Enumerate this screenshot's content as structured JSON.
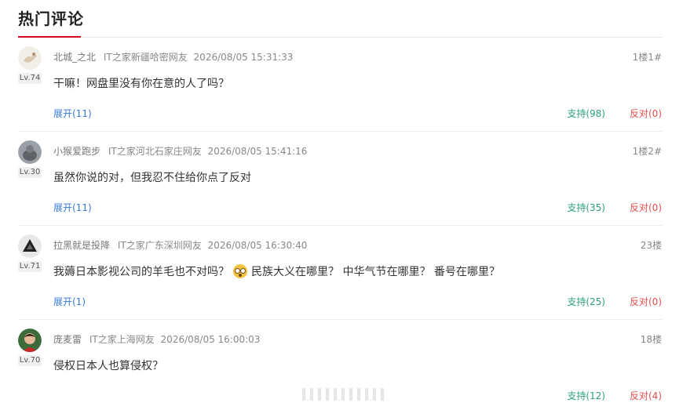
{
  "section_title": "热门评论",
  "comments": [
    {
      "nickname": "北城_之北",
      "source": "IT之家新疆哈密网友",
      "time": "2026/08/05 15:31:33",
      "floor": "1楼1#",
      "level": "Lv.74",
      "text": "干嘛！网盘里没有你在意的人了吗？",
      "expand": "展开(11)",
      "support": "支持(98)",
      "oppose": "反对(0)"
    },
    {
      "nickname": "小猴爱跑步",
      "source": "IT之家河北石家庄网友",
      "time": "2026/08/05 15:41:16",
      "floor": "1楼2#",
      "level": "Lv.30",
      "text": "虽然你说的对，但我忍不住给你点了反对",
      "expand": "展开(11)",
      "support": "支持(35)",
      "oppose": "反对(0)"
    },
    {
      "nickname": "拉黑就是投降",
      "source": "IT之家广东深圳网友",
      "time": "2026/08/05 16:30:40",
      "floor": "23楼",
      "level": "Lv.71",
      "text_a": "我薅日本影视公司的羊毛也不对吗？",
      "text_b": "民族大义在哪里？ 中华气节在哪里？ 番号在哪里？",
      "expand": "展开(1)",
      "support": "支持(25)",
      "oppose": "反对(0)"
    },
    {
      "nickname": "庞麦雷",
      "source": "IT之家上海网友",
      "time": "2026/08/05 16:00:03",
      "floor": "18楼",
      "level": "Lv.70",
      "text": "侵权日本人也算侵权？",
      "support": "支持(12)",
      "oppose": "反对(4)"
    }
  ],
  "colors": {
    "accent": "#d0021b",
    "link": "#3a7bd5",
    "support": "#2aa27a",
    "oppose": "#e04c4c"
  }
}
